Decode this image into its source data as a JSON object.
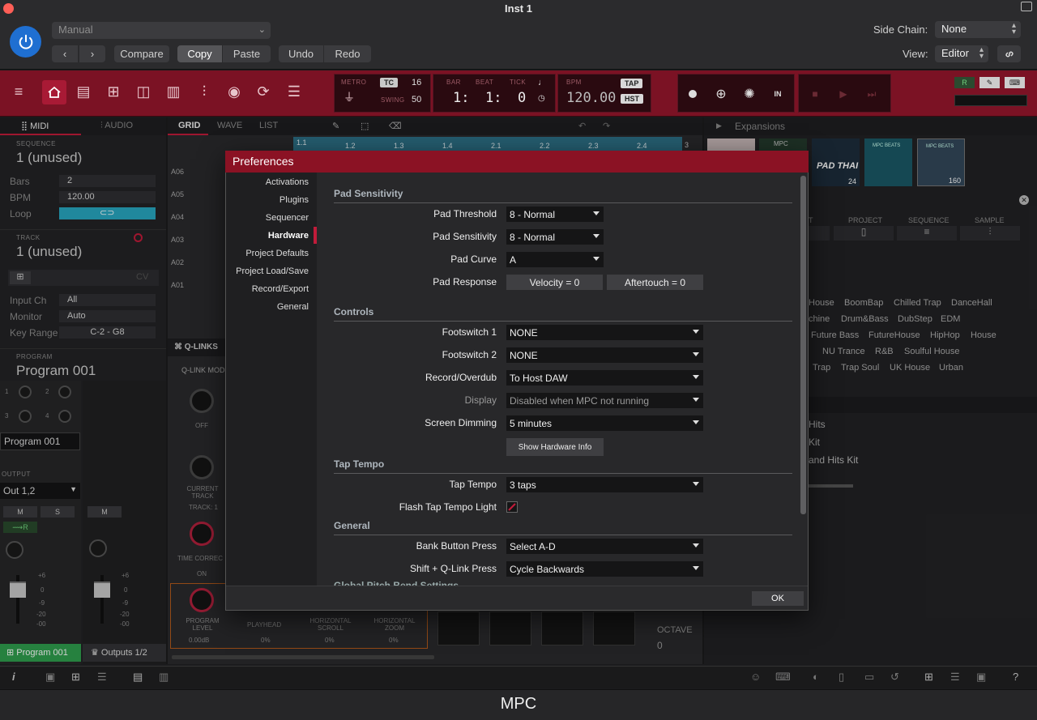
{
  "window": {
    "title": "Inst 1",
    "footer_title": "MPC"
  },
  "host": {
    "preset": "Manual",
    "compare": "Compare",
    "copy": "Copy",
    "paste": "Paste",
    "undo": "Undo",
    "redo": "Redo",
    "side_chain_label": "Side Chain:",
    "side_chain_value": "None",
    "view_label": "View:",
    "view_value": "Editor"
  },
  "transport": {
    "metro": "METRO",
    "tc": "TC",
    "tc_value": "16",
    "swing": "SWING",
    "swing_value": "50",
    "bar_label": "BAR",
    "beat_label": "BEAT",
    "tick_label": "TICK",
    "bar": "1:",
    "beat": "1:",
    "tick": "0",
    "bpm_label": "BPM",
    "bpm": "120.00",
    "tap": "TAP",
    "hst": "HST"
  },
  "left_panel": {
    "tab_midi": "MIDI",
    "tab_audio": "AUDIO",
    "sequence_label": "SEQUENCE",
    "sequence_name": "1 (unused)",
    "bars_label": "Bars",
    "bars_value": "2",
    "bpm_label": "BPM",
    "bpm_value": "120.00",
    "loop_label": "Loop",
    "track_label": "TRACK",
    "track_name": "1 (unused)",
    "cv_label": "CV",
    "input_ch_label": "Input Ch",
    "input_ch_value": "All",
    "monitor_label": "Monitor",
    "monitor_value": "Auto",
    "key_range_label": "Key Range",
    "key_range_value": "C-2 - G8",
    "program_label": "PROGRAM",
    "program_name": "Program 001",
    "program_box": "Program 001",
    "output_label": "OUTPUT",
    "output_value": "Out 1,2",
    "m": "M",
    "s": "S",
    "r": "R",
    "knob_nums": [
      "1",
      "2",
      "3",
      "4"
    ],
    "db_marks": [
      "+6",
      "0",
      "-9",
      "-20",
      "-00"
    ],
    "bottom_tab_program": "Program 001",
    "bottom_tab_outputs": "Outputs 1/2"
  },
  "center": {
    "tab_grid": "GRID",
    "tab_wave": "WAVE",
    "tab_list": "LIST",
    "ruler": [
      "1.1",
      "1.2",
      "1.3",
      "1.4",
      "2.1",
      "2.2",
      "2.3",
      "2.4",
      "3"
    ],
    "rows": [
      "A06",
      "A05",
      "A04",
      "A03",
      "A02",
      "A01"
    ],
    "qlinks_label": "Q-LINKS",
    "qlink_mode": "Q-LINK MOD",
    "off_label": "OFF",
    "current_track": "CURRENT TRACK",
    "track_num": "TRACK: 1",
    "time_correct": "TIME CORREC",
    "on_label": "ON",
    "program_level": "PROGRAM LEVEL",
    "program_level_value": "0.00dB",
    "playhead": "PLAYHEAD",
    "playhead_value": "0%",
    "h_scroll": "HORIZONTAL SCROLL",
    "h_scroll_value": "0%",
    "h_zoom": "HORIZONTAL ZOOM",
    "h_zoom_value": "0%",
    "octave": "OCTAVE",
    "octave_value": "0"
  },
  "right_panel": {
    "title": "Expansions",
    "thumb_counts": [
      "24",
      "160"
    ],
    "thumb_labels": [
      "MPC",
      "PAD THAI",
      "MPC BEATS",
      "MPC BEATS"
    ],
    "col_project": "PROJECT",
    "col_sequence": "SEQUENCE",
    "col_sample": "SAMPLE",
    "col_partial": "T",
    "tags": [
      [
        "House",
        "BoomBap",
        "Chilled Trap",
        "DanceHall"
      ],
      [
        "chine",
        "Drum&Bass",
        "DubStep",
        "EDM"
      ],
      [
        "Future Bass",
        "FutureHouse",
        "HipHop",
        "House"
      ],
      [
        "NU Trance",
        "R&B",
        "Soulful House"
      ],
      [
        "Trap",
        "Trap Soul",
        "UK House",
        "Urban"
      ]
    ],
    "list": [
      "Hits",
      "Kit",
      "and Hits Kit"
    ]
  },
  "dialog": {
    "title": "Preferences",
    "nav": [
      "Activations",
      "Plugins",
      "Sequencer",
      "Hardware",
      "Project Defaults",
      "Project Load/Save",
      "Record/Export",
      "General"
    ],
    "active_nav": "Hardware",
    "pad_sensitivity": {
      "title": "Pad Sensitivity",
      "pad_threshold_label": "Pad Threshold",
      "pad_threshold_value": "8 - Normal",
      "pad_sensitivity_label": "Pad Sensitivity",
      "pad_sensitivity_value": "8 - Normal",
      "pad_curve_label": "Pad Curve",
      "pad_curve_value": "A",
      "pad_response_label": "Pad Response",
      "velocity": "Velocity = 0",
      "aftertouch": "Aftertouch = 0"
    },
    "controls": {
      "title": "Controls",
      "footswitch1_label": "Footswitch 1",
      "footswitch1_value": "NONE",
      "footswitch2_label": "Footswitch 2",
      "footswitch2_value": "NONE",
      "record_overdub_label": "Record/Overdub",
      "record_overdub_value": "To Host DAW",
      "display_label": "Display",
      "display_value": "Disabled when MPC not running",
      "screen_dimming_label": "Screen Dimming",
      "screen_dimming_value": "5 minutes",
      "show_hw_info": "Show Hardware Info"
    },
    "tap_tempo": {
      "title": "Tap Tempo",
      "tap_tempo_label": "Tap Tempo",
      "tap_tempo_value": "3 taps",
      "flash_label": "Flash Tap Tempo Light"
    },
    "general": {
      "title": "General",
      "bank_label": "Bank Button Press",
      "bank_value": "Select A-D",
      "shift_label": "Shift + Q-Link Press",
      "shift_value": "Cycle Backwards",
      "next_section": "Global Pitch Bend Settings"
    },
    "ok": "OK"
  },
  "colors": {
    "accent_red": "#8b1224",
    "toolbar_red": "#7b1224",
    "power_blue": "#1f6fd1",
    "loop_cyan": "#28a7c0"
  }
}
